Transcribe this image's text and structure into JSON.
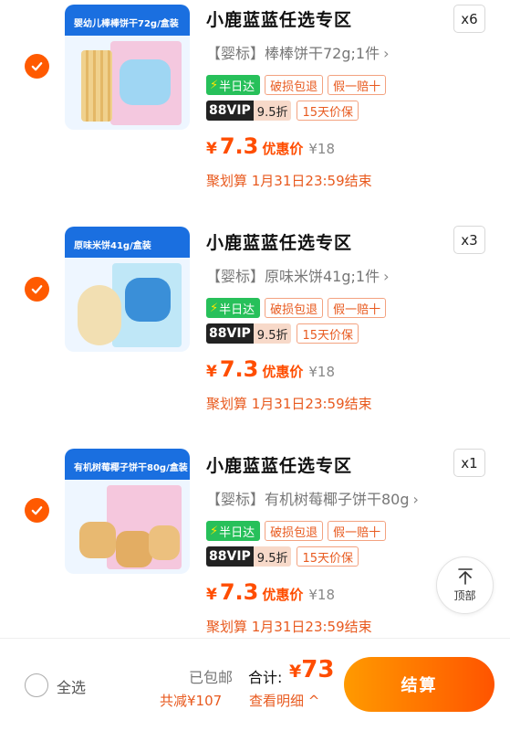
{
  "items": [
    {
      "store": "小鹿蓝蓝任选专区",
      "qty": "x6",
      "sku": "【婴标】棒棒饼干72g;1件",
      "banner": "婴幼儿棒棒饼干72g/盒装",
      "tags": [
        "半日达",
        "破损包退",
        "假一赔十"
      ],
      "vip": "88VIP",
      "discount": "9.5折",
      "guarantee": "15天价保",
      "currency": "¥",
      "price": "7.3",
      "price_label": "优惠价",
      "orig_price": "¥18",
      "promo": "聚划算 1月31日23:59结束"
    },
    {
      "store": "小鹿蓝蓝任选专区",
      "qty": "x3",
      "sku": "【婴标】原味米饼41g;1件",
      "banner": "原味米饼41g/盒装",
      "tags": [
        "半日达",
        "破损包退",
        "假一赔十"
      ],
      "vip": "88VIP",
      "discount": "9.5折",
      "guarantee": "15天价保",
      "currency": "¥",
      "price": "7.3",
      "price_label": "优惠价",
      "orig_price": "¥18",
      "promo": "聚划算 1月31日23:59结束"
    },
    {
      "store": "小鹿蓝蓝任选专区",
      "qty": "x1",
      "sku": "【婴标】有机树莓椰子饼干80g",
      "banner": "有机树莓椰子饼干80g/盒装",
      "tags": [
        "半日达",
        "破损包退",
        "假一赔十"
      ],
      "vip": "88VIP",
      "discount": "9.5折",
      "guarantee": "15天价保",
      "currency": "¥",
      "price": "7.3",
      "price_label": "优惠价",
      "orig_price": "¥18",
      "promo": "聚划算 1月31日23:59结束"
    }
  ],
  "back_to_top": "顶部",
  "footer": {
    "select_all": "全选",
    "free_shipping": "已包邮",
    "total_label": "合计:",
    "total_currency": "¥",
    "total_value": "73",
    "saved": "共减¥107",
    "detail": "查看明细",
    "checkout": "结算"
  },
  "colors": {
    "accent": "#ff5a00",
    "price": "#ff4d00",
    "fast_tag": "#27c05a",
    "banner": "#1a6fe0"
  },
  "icons": [
    "check-icon",
    "chevron-right-icon",
    "lightning-icon",
    "arrow-up-icon",
    "chevron-up-icon"
  ]
}
